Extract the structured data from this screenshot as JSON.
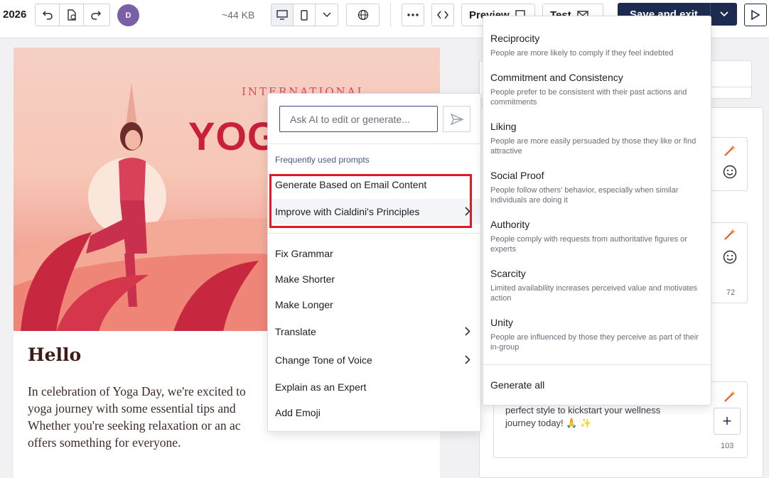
{
  "toolbar": {
    "year": "2026",
    "avatar_initial": "D",
    "size": "~44 KB",
    "preview_label": "Preview",
    "test_label": "Test",
    "save_label": "Save and exit"
  },
  "email": {
    "hero_subtitle": "INTERNATIONAL",
    "hero_title": "YOG",
    "greeting": "Hello",
    "body": "In celebration of Yoga Day, we're excited to yoga journey with some essential tips and Whether you're seeking relaxation or an ac offers something for everyone.",
    "body_lines": [
      "In celebration of Yoga Day, we're excited to",
      "yoga journey with some essential tips and",
      "Whether you're seeking relaxation or an ac",
      "offers something for everyone."
    ]
  },
  "right_panel": {
    "count_1": "72",
    "snippet_line_1": "perfect style to kickstart your wellness",
    "snippet_line_2": "journey today! 🙏 ✨",
    "count_2": "103"
  },
  "ai_popup": {
    "input_placeholder": "Ask AI to edit or generate...",
    "section_label": "Frequently used prompts",
    "items": [
      {
        "label": "Generate Based on Email Content"
      },
      {
        "label": "Improve with Cialdini's Principles"
      },
      {
        "label": "Fix Grammar"
      },
      {
        "label": "Make Shorter"
      },
      {
        "label": "Make Longer"
      },
      {
        "label": "Translate"
      },
      {
        "label": "Change Tone of Voice"
      },
      {
        "label": "Explain as an Expert"
      },
      {
        "label": "Add Emoji"
      }
    ]
  },
  "cialdini_menu": {
    "items": [
      {
        "title": "Reciprocity",
        "desc": "People are more likely to comply if they feel indebted"
      },
      {
        "title": "Commitment and Consistency",
        "desc": "People prefer to be consistent with their past actions and commitments"
      },
      {
        "title": "Liking",
        "desc": "People are more easily persuaded by those they like or find attractive"
      },
      {
        "title": "Social Proof",
        "desc": "People follow others' behavior, especially when similar individuals are doing it"
      },
      {
        "title": "Authority",
        "desc": "People comply with requests from authoritative figures or experts"
      },
      {
        "title": "Scarcity",
        "desc": "Limited availability increases perceived value and motivates action"
      },
      {
        "title": "Unity",
        "desc": "People are influenced by those they perceive as part of their in-group"
      }
    ],
    "generate_all": "Generate all"
  },
  "colors": {
    "primary_dark": "#1c2b4f",
    "highlight_red": "#e11a22",
    "hero_red": "#c8203a"
  }
}
